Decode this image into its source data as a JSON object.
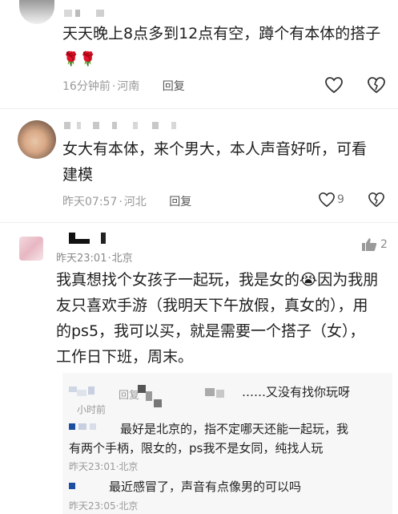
{
  "comments": [
    {
      "text_line1": "天天晚上8点多到12点有空，蹲个有本体的搭子",
      "emoji": "🌹🌹",
      "time": "16分钟前",
      "location": "河南",
      "reply_label": "回复"
    },
    {
      "text_line1": "女大有本体，来个男大，本人声音好听，可看",
      "text_line2": "建模",
      "time": "昨天07:57",
      "location": "河北",
      "reply_label": "回复",
      "like_count": "9"
    },
    {
      "time": "昨天23:01",
      "location": "北京",
      "like_count": "2",
      "text_line1": "我真想找个女孩子一起玩，我是女的😭因为我朋",
      "text_line2": "友只喜欢手游（我明天下午放假，真女的），用",
      "text_line3": "的ps5，我可以买，就是需要一个搭子（女），",
      "text_line4": "工作日下班，周末。"
    }
  ],
  "replies": [
    {
      "text": "……又没有找你玩呀",
      "reply_label": "回复",
      "time": "小时前",
      "location": ""
    },
    {
      "text_line1": "最好是北京的，指不定哪天还能一起玩，我",
      "text_line2": "有两个手柄，限女的，ps我不是女同，纯找人玩",
      "time": "昨天23:01",
      "location": "北京"
    },
    {
      "text": "最近感冒了，声音有点像男的可以吗",
      "time": "昨天23:05",
      "location": "北京"
    }
  ],
  "separator": "·",
  "colors": {
    "background": "#ffffff",
    "meta": "#9a9a9a",
    "text": "#1f1f1f",
    "reply_box": "#f7f7f7"
  }
}
